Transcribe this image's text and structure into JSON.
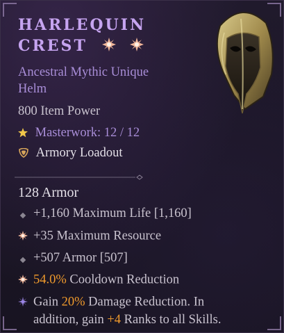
{
  "item": {
    "name_line1": "HARLEQUIN",
    "name_line2": "CREST",
    "rarity_line1": "Ancestral Mythic Unique",
    "rarity_line2": "Helm",
    "item_power": "800 Item Power",
    "masterwork_label": "Masterwork: 12 / 12",
    "armory_label": "Armory Loadout",
    "armor": "128 Armor"
  },
  "affixes": [
    {
      "text": "+1,160 Maximum Life [1,160]",
      "bullet": "diamond-bullet-icon"
    },
    {
      "text": "+35 Maximum Resource",
      "bullet": "greater-affix-icon"
    },
    {
      "text": "+507 Armor [507]",
      "bullet": "diamond-bullet-icon"
    },
    {
      "value": "54.0%",
      "text": " Cooldown Reduction",
      "bullet": "greater-affix-icon"
    }
  ],
  "unique_power": {
    "bullet": "unique-power-icon",
    "line1_a": "Gain ",
    "line1_value": "20%",
    "line1_b": " Damage Reduction. In",
    "line2_a": "addition, gain ",
    "line2_value": "+4",
    "line2_b": " Ranks to all Skills."
  },
  "colors": {
    "title": "#c6a4f0",
    "rarity": "#a98ed8",
    "stat_text": "#c9c3cf",
    "highlight": "#f09a2c",
    "background": "#1b1626"
  }
}
